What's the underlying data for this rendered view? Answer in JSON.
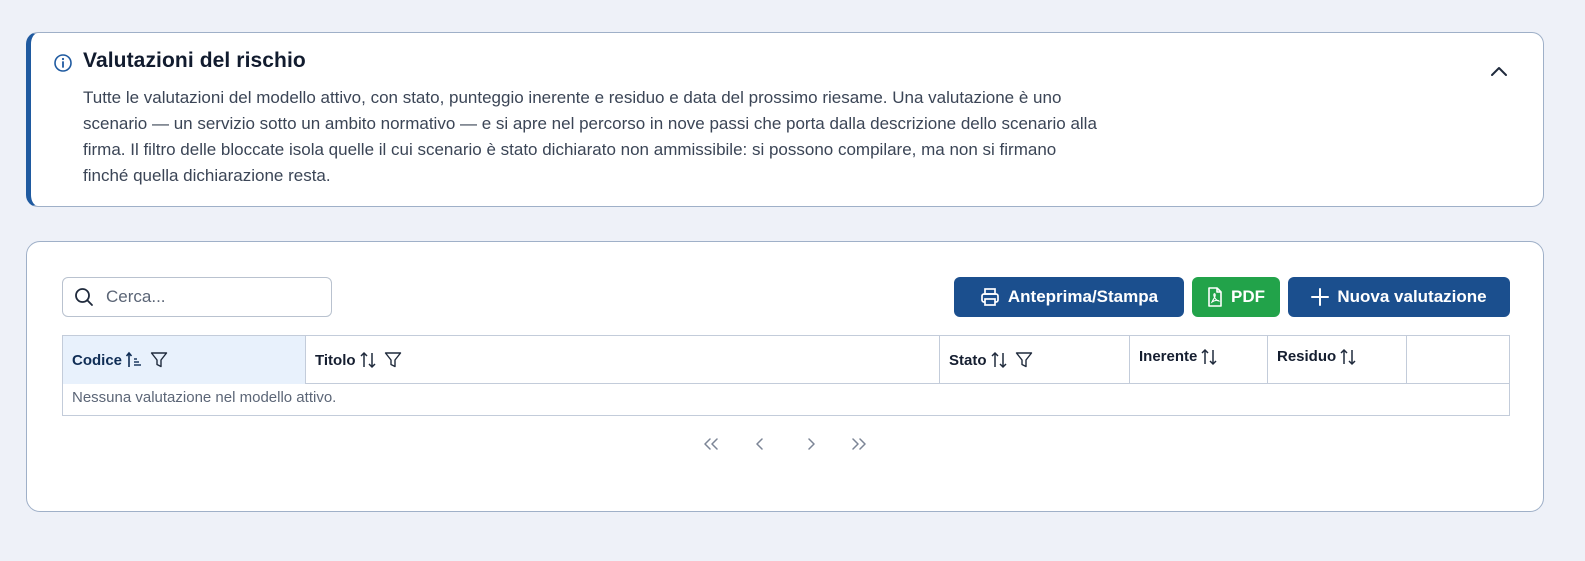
{
  "info": {
    "title": "Valutazioni del rischio",
    "description": "Tutte le valutazioni del modello attivo, con stato, punteggio inerente e residuo e data del prossimo riesame. Una valutazione è uno scenario — un servizio sotto un ambito normativo — e si apre nel percorso in nove passi che porta dalla descrizione dello scenario alla firma. Il filtro delle bloccate isola quelle il cui scenario è stato dichiarato non ammissibile: si possono compilare, ma non si firmano finché quella dichiarazione resta.",
    "icon": "info-circle-icon",
    "collapse_icon": "chevron-up-icon"
  },
  "toolbar": {
    "search_placeholder": "Cerca...",
    "search_value": "",
    "print_label": "Anteprima/Stampa",
    "pdf_label": "PDF",
    "new_label": "Nuova valutazione"
  },
  "table": {
    "columns": [
      {
        "label": "Codice",
        "sortable": true,
        "sorted": "asc",
        "filterable": true
      },
      {
        "label": "Titolo",
        "sortable": true,
        "filterable": true
      },
      {
        "label": "Stato",
        "sortable": true,
        "filterable": true
      },
      {
        "label": "Inerente",
        "sortable": true,
        "filterable": false
      },
      {
        "label": "Residuo",
        "sortable": true,
        "filterable": false
      },
      {
        "label": "",
        "sortable": false,
        "filterable": false
      }
    ],
    "empty_message": "Nessuna valutazione nel modello attivo."
  },
  "pager": {
    "first_icon": "double-chevron-left-icon",
    "prev_icon": "chevron-left-icon",
    "next_icon": "chevron-right-icon",
    "last_icon": "double-chevron-right-icon"
  },
  "colors": {
    "primary": "#1b4f8e",
    "success": "#22a34a",
    "accent_border": "#1f5aa0",
    "sorted_header": "#e8f1fc"
  }
}
